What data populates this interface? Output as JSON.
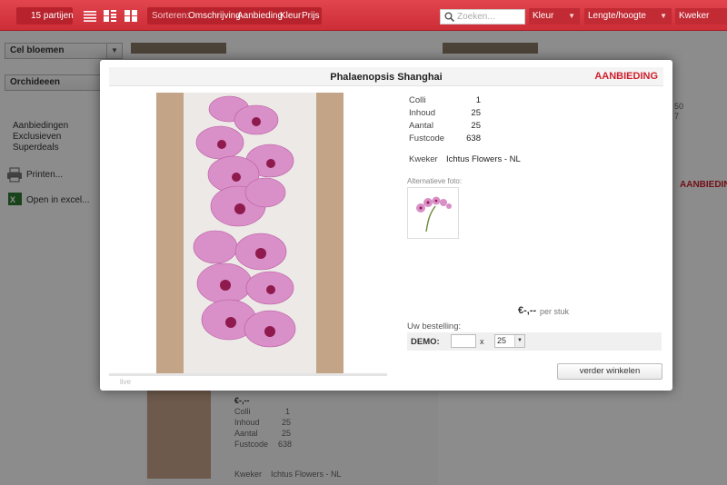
{
  "toolbar": {
    "lot_count": "15 partijen",
    "sort_label": "Sorteren:",
    "sort_options": [
      "Omschrijving",
      "Aanbieding",
      "Kleur",
      "Prijs"
    ],
    "search_placeholder": "Zoeken...",
    "filter_color": "Kleur",
    "filter_length": "Lengte/hoogte",
    "filter_grower": "Kweker"
  },
  "sidebar": {
    "group_select": "Cel bloemen",
    "type_select": "Orchideeen",
    "links": [
      "Aanbiedingen",
      "Exclusieven",
      "Superdeals"
    ],
    "print": "Printen...",
    "excel": "Open in excel..."
  },
  "background": {
    "badge": "AANBIEDING",
    "price": "€-,--",
    "colli_label": "Colli",
    "colli": "1",
    "inhoud_label": "Inhoud",
    "inhoud": "25",
    "aantal_label": "Aantal",
    "aantal": "25",
    "fust_label": "Fustcode",
    "fust": "638",
    "kweker_label": "Kweker",
    "kweker": "Ichtus Flowers - NL",
    "side_nums": [
      "50",
      "7"
    ]
  },
  "modal": {
    "title": "Phalaenopsis Shanghai",
    "badge": "AANBIEDING",
    "specs": [
      {
        "label": "Colli",
        "value": "1"
      },
      {
        "label": "Inhoud",
        "value": "25"
      },
      {
        "label": "Aantal",
        "value": "25"
      },
      {
        "label": "Fustcode",
        "value": "638"
      }
    ],
    "kweker_label": "Kweker",
    "kweker": "Ichtus Flowers - NL",
    "alt_photo_label": "Alternatieve foto:",
    "price": "€-,--",
    "price_unit": "per stuk",
    "order_label": "Uw bestelling:",
    "demo_label": "DEMO:",
    "qty_value": "",
    "x": "x",
    "pack_value": "25",
    "continue_button": "verder winkelen",
    "photo_caption": "live"
  }
}
